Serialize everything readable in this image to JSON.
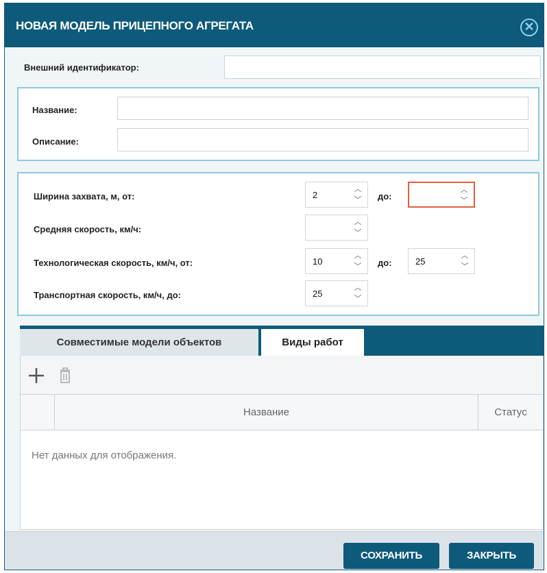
{
  "dialog": {
    "title": "НОВАЯ МОДЕЛЬ ПРИЦЕПНОГО АГРЕГАТА",
    "close_icon": "close-circle-icon"
  },
  "form": {
    "external_id_label": "Внешний идентификатор:",
    "external_id_value": "",
    "name_label": "Название:",
    "name_value": "",
    "description_label": "Описание:",
    "description_value": ""
  },
  "params": {
    "width_label": "Ширина захвата, м, от:",
    "width_from": "2",
    "width_to_label": "до:",
    "width_to": "",
    "avg_speed_label": "Средняя скорость, км/ч:",
    "avg_speed": "",
    "tech_speed_label": "Технологическая скорость, км/ч, от:",
    "tech_speed_from": "10",
    "tech_speed_to_label": "до:",
    "tech_speed_to": "25",
    "transport_speed_label": "Транспортная скорость, км/ч, до:",
    "transport_speed": "25"
  },
  "tabs": [
    {
      "label": "Совместимые модели объектов"
    },
    {
      "label": "Виды работ"
    }
  ],
  "toolbar": {
    "add_icon": "plus-icon",
    "delete_icon": "trash-icon"
  },
  "grid": {
    "columns": [
      "Название",
      "Статус"
    ],
    "empty_text": "Нет данных для отображения."
  },
  "footer": {
    "save_label": "СОХРАНИТЬ",
    "close_label": "ЗАКРЫТЬ"
  },
  "colors": {
    "header": "#0e5a7a",
    "panel_border": "#8cc8e0",
    "invalid_border": "#e35e3a"
  }
}
